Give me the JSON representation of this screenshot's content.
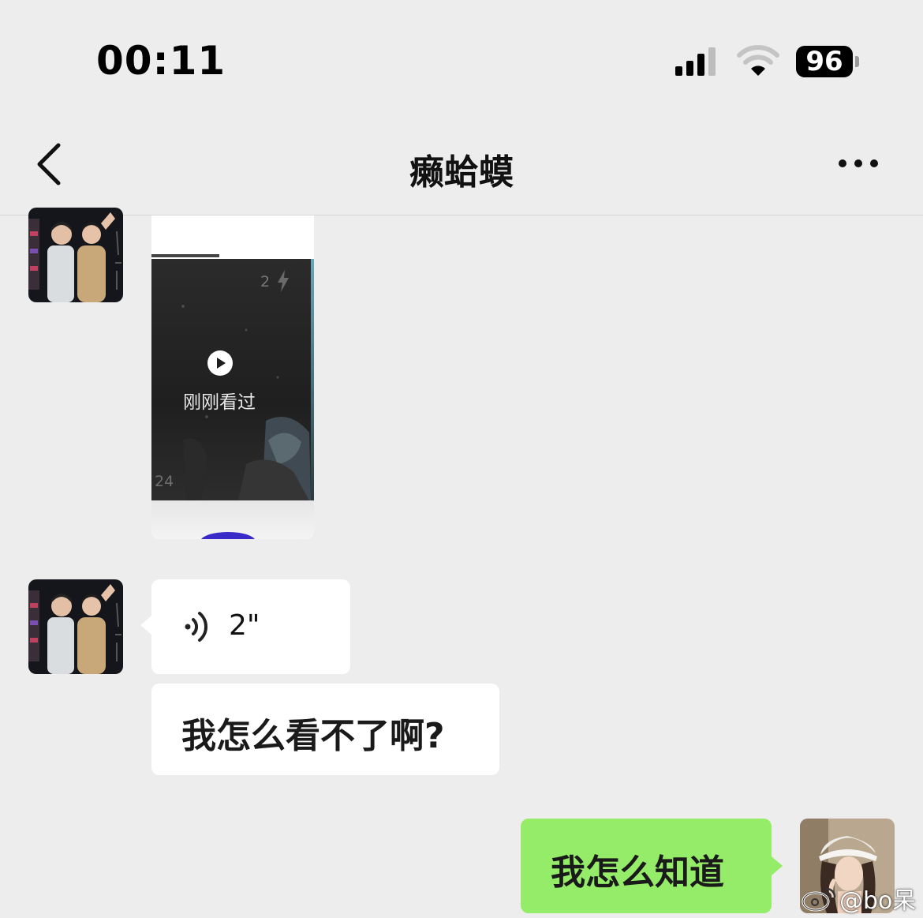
{
  "status_bar": {
    "time": "00:11",
    "battery_level": "96"
  },
  "nav": {
    "title": "癞蛤蟆"
  },
  "messages": {
    "video_card": {
      "frame_count": "2",
      "viewed_label": "刚刚看过",
      "like_count": "24"
    },
    "voice": {
      "duration": "2\""
    },
    "incoming_text": "我怎么看不了啊?",
    "outgoing_text": "我怎么知道"
  },
  "watermark": {
    "text": "@bo呆"
  },
  "colors": {
    "background": "#ededed",
    "outgoing_bubble": "#95ec69",
    "incoming_bubble": "#ffffff"
  }
}
